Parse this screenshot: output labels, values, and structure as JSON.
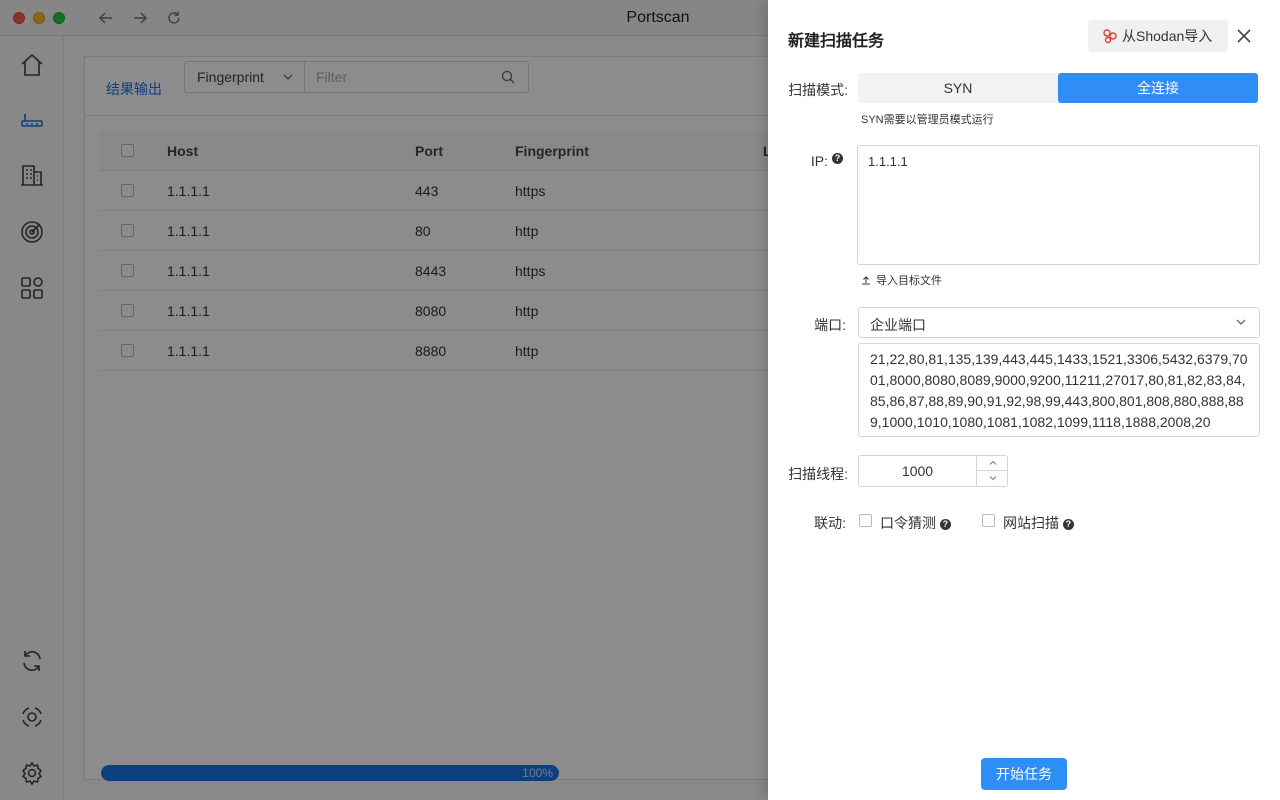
{
  "window": {
    "title": "Portscan"
  },
  "main": {
    "tab_label": "结果输出",
    "filter_field": "Fingerprint",
    "filter_placeholder": "Filter",
    "columns": {
      "host": "Host",
      "port": "Port",
      "fingerprint": "Fingerprint",
      "extra": "L"
    },
    "rows": [
      {
        "host": "1.1.1.1",
        "port": "443",
        "fingerprint": "https"
      },
      {
        "host": "1.1.1.1",
        "port": "80",
        "fingerprint": "http"
      },
      {
        "host": "1.1.1.1",
        "port": "8443",
        "fingerprint": "https"
      },
      {
        "host": "1.1.1.1",
        "port": "8080",
        "fingerprint": "http"
      },
      {
        "host": "1.1.1.1",
        "port": "8880",
        "fingerprint": "http"
      }
    ],
    "progress": {
      "value": 100,
      "label": "100%"
    }
  },
  "drawer": {
    "title": "新建扫描任务",
    "import_shodan": "从Shodan导入",
    "scan_mode": {
      "label": "扫描模式:",
      "options": [
        "SYN",
        "全连接"
      ],
      "selected": "全连接",
      "hint": "SYN需要以管理员模式运行"
    },
    "ip": {
      "label": "IP:",
      "value": "1.1.1.1",
      "upload": "导入目标文件"
    },
    "port": {
      "label": "端口:",
      "preset": "企业端口",
      "list": "21,22,80,81,135,139,443,445,1433,1521,3306,5432,6379,7001,8000,8080,8089,9000,9200,11211,27017,80,81,82,83,84,85,86,87,88,89,90,91,92,98,99,443,800,801,808,880,888,889,1000,1010,1080,1081,1082,1099,1118,1888,2008,20"
    },
    "threads": {
      "label": "扫描线程:",
      "value": "1000"
    },
    "linkage": {
      "label": "联动:",
      "password_guess": "口令猜测",
      "web_scan": "网站扫描"
    },
    "start_button": "开始任务"
  },
  "colors": {
    "accent": "#2e8ef5",
    "progress": "#1a73e8"
  }
}
